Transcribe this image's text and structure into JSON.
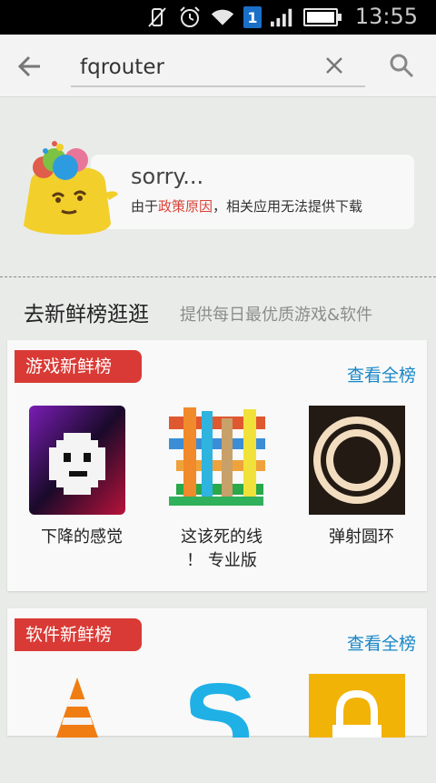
{
  "status_bar": {
    "time": "13:55",
    "sim_label": "1"
  },
  "search": {
    "query": "fqrouter"
  },
  "sorry": {
    "title": "sorry...",
    "msg_prefix": "由于",
    "msg_reason": "政策原因",
    "msg_suffix": "，相关应用无法提供下载"
  },
  "section": {
    "title": "去新鲜榜逛逛",
    "subtitle": "提供每日最优质游戏&软件"
  },
  "game_card": {
    "tag": "游戏新鲜榜",
    "more": "查看全榜",
    "apps": [
      {
        "name": "下降的感觉",
        "icon": "ghost-face-icon"
      },
      {
        "name": "这该死的线\n！ 专业版",
        "icon": "lines-grid-icon"
      },
      {
        "name": "弹射圆环",
        "icon": "ring-icon"
      }
    ]
  },
  "software_card": {
    "tag": "软件新鲜榜",
    "more": "查看全榜",
    "apps": [
      {
        "icon": "vlc-cone-icon"
      },
      {
        "icon": "skype-s-icon"
      },
      {
        "icon": "lock-icon"
      }
    ]
  },
  "colors": {
    "accent_red": "#d93a35",
    "link_blue": "#1a86c8"
  }
}
